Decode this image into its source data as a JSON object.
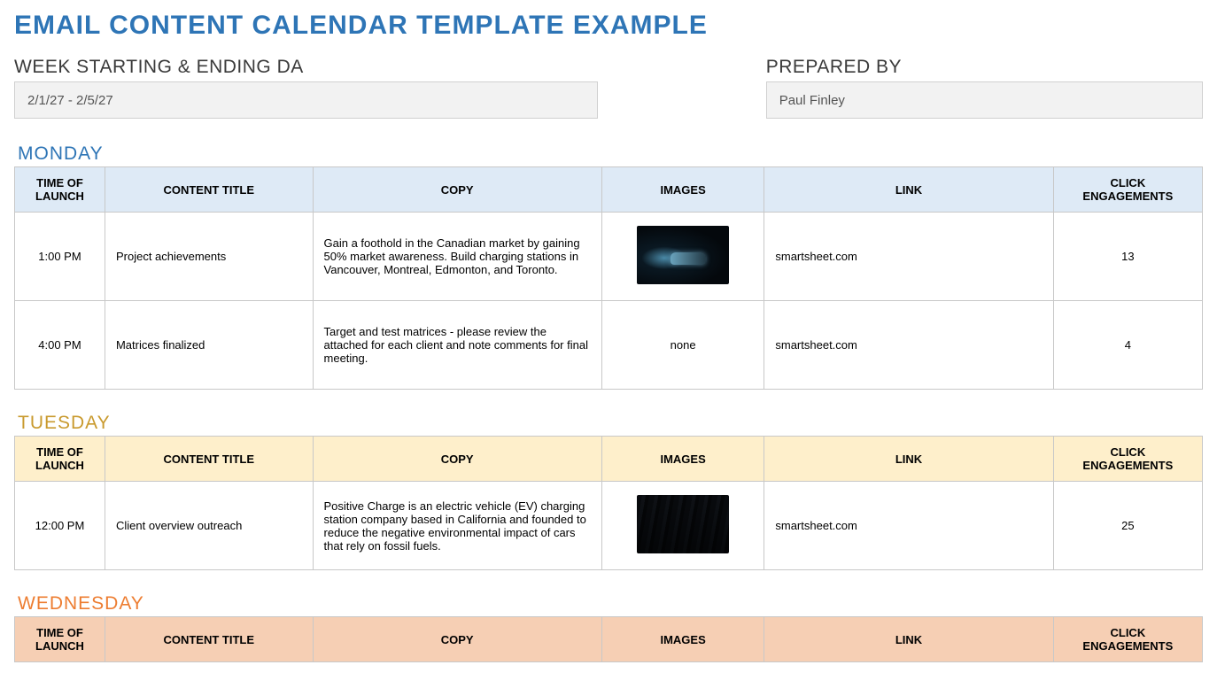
{
  "title": "EMAIL CONTENT CALENDAR TEMPLATE EXAMPLE",
  "meta": {
    "week_label": "WEEK STARTING & ENDING DA",
    "week_value": "2/1/27 - 2/5/27",
    "prepared_label": "PREPARED BY",
    "prepared_value": "Paul Finley"
  },
  "columns": {
    "time": "TIME OF LAUNCH",
    "title": "CONTENT TITLE",
    "copy": "COPY",
    "images": "IMAGES",
    "link": "LINK",
    "clicks": "CLICK ENGAGEMENTS"
  },
  "days": [
    {
      "name": "MONDAY",
      "class": "monday",
      "rows": [
        {
          "time": "1:00 PM",
          "title": "Project achievements",
          "copy": "Gain a foothold in the Canadian market by gaining 50% market awareness. Build charging stations in Vancouver, Montreal, Edmonton, and Toronto.",
          "image_type": "ev",
          "image_alt": "electric-car-charging",
          "link": "smartsheet.com",
          "clicks": "13"
        },
        {
          "time": "4:00 PM",
          "title": "Matrices finalized",
          "copy": "Target and test matrices - please review the attached for each client and note comments for final meeting.",
          "image_type": "none",
          "image_text": "none",
          "link": "smartsheet.com",
          "clicks": "4"
        }
      ]
    },
    {
      "name": "TUESDAY",
      "class": "tuesday",
      "rows": [
        {
          "time": "12:00 PM",
          "title": "Client overview outreach",
          "copy": "Positive Charge is an electric vehicle (EV) charging station company based in California and founded to reduce the negative environmental impact of cars that rely on fossil fuels.",
          "image_type": "traffic",
          "image_alt": "traffic-congestion",
          "link": "smartsheet.com",
          "clicks": "25"
        }
      ]
    },
    {
      "name": "WEDNESDAY",
      "class": "wednesday",
      "rows": []
    }
  ]
}
